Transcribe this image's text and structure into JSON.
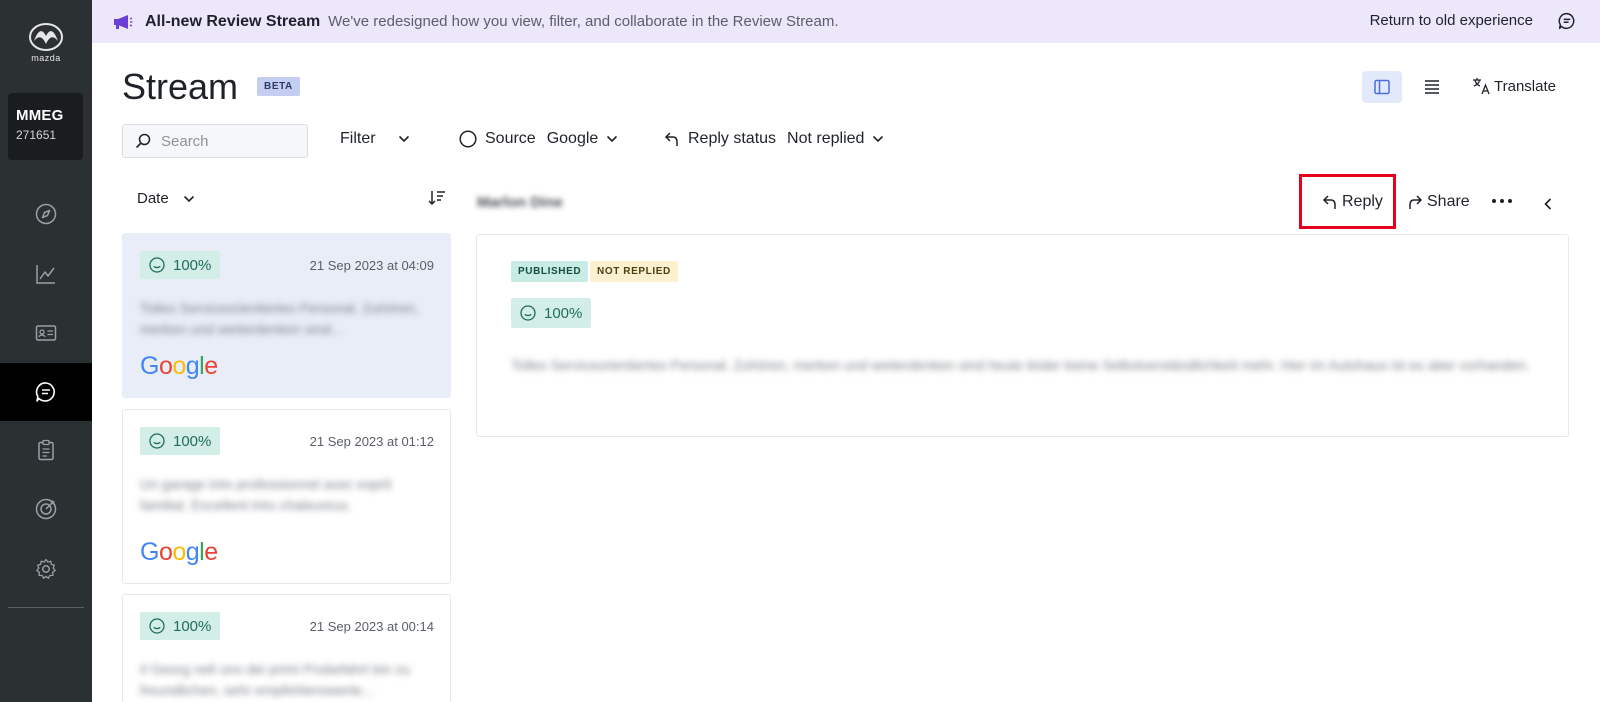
{
  "sidebar": {
    "logo_text": "mazda",
    "account_name": "MMEG",
    "account_id": "271651",
    "nav_items": [
      "compass",
      "analytics",
      "contacts",
      "reviews",
      "surveys",
      "goals",
      "settings"
    ]
  },
  "banner": {
    "title": "All-new Review Stream",
    "description": "We've redesigned how you view, filter, and collaborate in the Review Stream.",
    "return_link": "Return to old experience"
  },
  "header": {
    "title": "Stream",
    "badge": "BETA",
    "translate_label": "Translate"
  },
  "filters": {
    "search_placeholder": "Search",
    "filter_label": "Filter",
    "source_label": "Source",
    "source_value": "Google",
    "reply_status_label": "Reply status",
    "reply_status_value": "Not replied"
  },
  "list": {
    "sort_label": "Date",
    "reviews": [
      {
        "score": "100%",
        "date": "21 Sep 2023 at 04:09",
        "excerpt": "Tolles Serviceorientiertes Personal. Zuhören, merken und weiterdenken sind...",
        "source": "Google"
      },
      {
        "score": "100%",
        "date": "21 Sep 2023 at 01:12",
        "excerpt": "Un garage très professionnel avec esprit familial. Excellent très chaleureux.",
        "source": "Google"
      },
      {
        "score": "100%",
        "date": "21 Sep 2023 at 00:14",
        "excerpt": "Il Georg nell uno dei primi Probefahrt bin zu freundlichen, sehr empfehlenswerte...",
        "source": "Google"
      }
    ]
  },
  "detail": {
    "reviewer_name": "Marlon Dine",
    "reply_label": "Reply",
    "share_label": "Share",
    "status_published": "PUBLISHED",
    "status_reply": "NOT REPLIED",
    "score": "100%",
    "text": "Tolles Serviceorientiertes Personal. Zuhören, merken und weiterdenken sind heute leider keine Selbstverständlichkeit mehr. Hier im Autohaus ist es aber vorhanden."
  },
  "colors": {
    "sidebar_bg": "#2b3033",
    "banner_bg": "#ece7fb",
    "accent_blue": "#4a6ee0",
    "score_bg": "#d3ede7",
    "highlight_red": "#e6001e"
  }
}
